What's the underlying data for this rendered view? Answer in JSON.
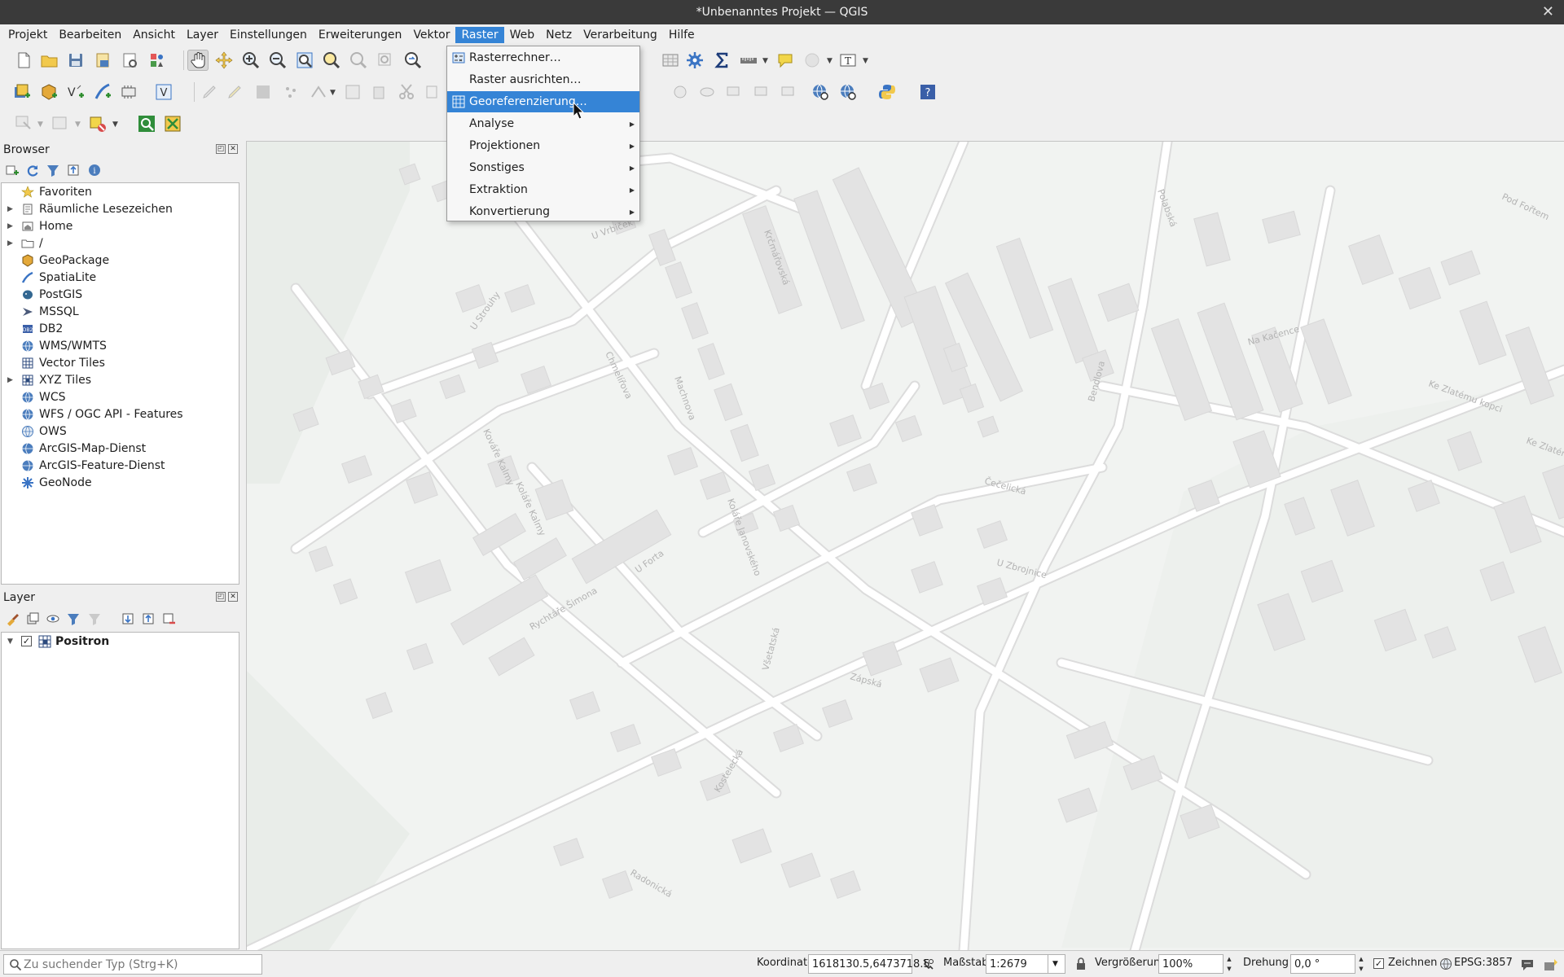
{
  "window": {
    "title": "*Unbenanntes Projekt — QGIS"
  },
  "menubar": {
    "items": [
      "Projekt",
      "Bearbeiten",
      "Ansicht",
      "Layer",
      "Einstellungen",
      "Erweiterungen",
      "Vektor",
      "Raster",
      "Web",
      "Netz",
      "Verarbeitung",
      "Hilfe"
    ],
    "active": "Raster"
  },
  "raster_menu": {
    "items": [
      {
        "label": "Rasterrechner…",
        "icon": "raster-calculator-icon",
        "submenu": false
      },
      {
        "label": "Raster ausrichten…",
        "icon": "",
        "submenu": false
      },
      {
        "label": "Georeferenzierung…",
        "icon": "georeferencer-icon",
        "submenu": false,
        "highlighted": true
      },
      {
        "label": "Analyse",
        "icon": "",
        "submenu": true
      },
      {
        "label": "Projektionen",
        "icon": "",
        "submenu": true
      },
      {
        "label": "Sonstiges",
        "icon": "",
        "submenu": true
      },
      {
        "label": "Extraktion",
        "icon": "",
        "submenu": true
      },
      {
        "label": "Konvertierung",
        "icon": "",
        "submenu": true
      }
    ]
  },
  "browser": {
    "title": "Browser",
    "items": [
      {
        "label": "Favoriten",
        "icon": "star-icon",
        "expandable": false
      },
      {
        "label": "Räumliche Lesezeichen",
        "icon": "bookmark-icon",
        "expandable": true
      },
      {
        "label": "Home",
        "icon": "home-folder-icon",
        "expandable": true
      },
      {
        "label": "/",
        "icon": "folder-icon",
        "expandable": true
      },
      {
        "label": "GeoPackage",
        "icon": "geopackage-icon",
        "expandable": false
      },
      {
        "label": "SpatiaLite",
        "icon": "spatialite-icon",
        "expandable": false
      },
      {
        "label": "PostGIS",
        "icon": "postgis-icon",
        "expandable": false
      },
      {
        "label": "MSSQL",
        "icon": "mssql-icon",
        "expandable": false
      },
      {
        "label": "DB2",
        "icon": "db2-icon",
        "expandable": false
      },
      {
        "label": "WMS/WMTS",
        "icon": "wms-globe-icon",
        "expandable": false
      },
      {
        "label": "Vector Tiles",
        "icon": "vector-tiles-icon",
        "expandable": false
      },
      {
        "label": "XYZ Tiles",
        "icon": "xyz-tiles-icon",
        "expandable": true
      },
      {
        "label": "WCS",
        "icon": "wcs-globe-icon",
        "expandable": false
      },
      {
        "label": "WFS / OGC API - Features",
        "icon": "wfs-globe-icon",
        "expandable": false
      },
      {
        "label": "OWS",
        "icon": "ows-globe-icon",
        "expandable": false
      },
      {
        "label": "ArcGIS-Map-Dienst",
        "icon": "arcgis-map-icon",
        "expandable": false
      },
      {
        "label": "ArcGIS-Feature-Dienst",
        "icon": "arcgis-feature-icon",
        "expandable": false
      },
      {
        "label": "GeoNode",
        "icon": "geonode-icon",
        "expandable": false
      }
    ]
  },
  "layers": {
    "title": "Layer",
    "items": [
      {
        "label": "Positron",
        "checked": true,
        "icon": "xyz-tiles-icon"
      }
    ]
  },
  "map": {
    "street_labels": [
      "U Vrbiček",
      "Polabská",
      "Krčmářovská",
      "Na Kačence",
      "Pod Fořtem",
      "Ke Zlatému kopci",
      "Ke Zlatému",
      "U Strouhy",
      "Chmelířova",
      "Machnova",
      "Kováře Kalmy",
      "Koláře Kalmy",
      "Rychtáře Šimona",
      "Koláře Janovského",
      "U Forta",
      "Čečelická",
      "U Zbrojnice",
      "Všetatská",
      "Bendlova",
      "Zápská",
      "Kostelecká",
      "Radonická"
    ]
  },
  "statusbar": {
    "search_placeholder": "Zu suchender Typ (Strg+K)",
    "coordinate_label": "Koordinate",
    "coordinate_value": "1618130.5,6473718.5",
    "scale_label": "Maßstab",
    "scale_value": "1:2679",
    "magnifier_label": "Vergrößerung",
    "magnifier_value": "100%",
    "rotation_label": "Drehung",
    "rotation_value": "0,0 °",
    "render_label": "Zeichnen",
    "render_checked": true,
    "crs_value": "EPSG:3857"
  },
  "colors": {
    "accent": "#3584d6",
    "map_bg": "#f1f3f1",
    "building": "#e3e3e3",
    "road": "#ffffff",
    "road_casing": "#dcdcdc",
    "map_label": "#b3b3b3"
  }
}
